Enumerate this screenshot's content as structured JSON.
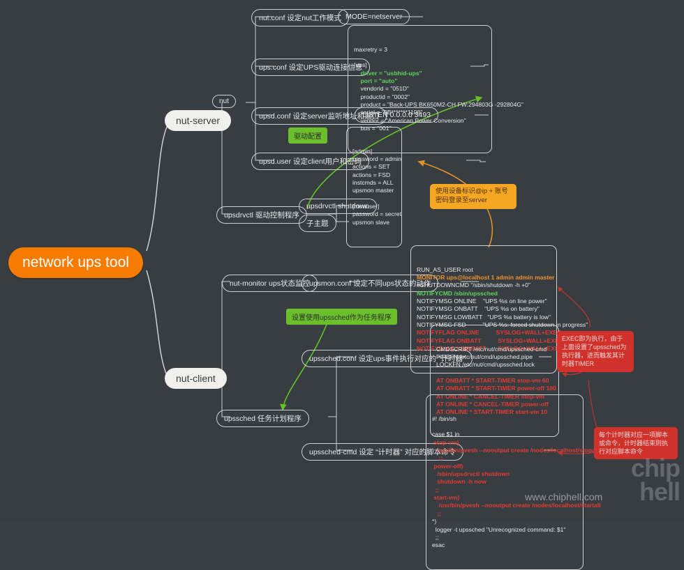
{
  "root": {
    "label": "network ups tool"
  },
  "branches": {
    "server": {
      "label": "nut-server"
    },
    "client": {
      "label": "nut-client"
    }
  },
  "server_tree": {
    "nut": {
      "label": "nut"
    },
    "nut_conf": {
      "label": "nut.conf  设定nut工作模式"
    },
    "nut_conf_value": {
      "label": "MODE=netserver"
    },
    "ups_conf": {
      "label": "ups.conf  设定UPS驱动连接信息"
    },
    "upsd_conf": {
      "label": "upsd.conf  设定server监听地址和端口"
    },
    "upsd_conf_value": {
      "label": "LISTEN 0.0.0.0 3493"
    },
    "upsd_user": {
      "label": "upsd.user  设定client用户和密码"
    },
    "upsdrvctl": {
      "label": "upsdrvctl  驱动控制程序"
    },
    "upsdrvctl_child1": {
      "label": "upsdrvctl shutdown"
    },
    "upsdrvctl_child2": {
      "label": "子主题"
    }
  },
  "client_tree": {
    "nut_monitor": {
      "label": "nut-monitor  ups状态监控"
    },
    "upsmon_conf": {
      "label": "upsmon.conf  设定不同ups状态的动作"
    },
    "upssched": {
      "label": "upssched   任务计划程序"
    },
    "upssched_conf": {
      "label": "upssched.conf  设定ups事件执行对应的 “计时器”"
    },
    "upssched_cmd": {
      "label": "upssched-cmd  设定 “计时器” 对应的脚本命令"
    }
  },
  "ups_conf_content": {
    "lines": [
      {
        "text": "maxretry = 3",
        "color": "w"
      },
      {
        "text": "",
        "color": "w"
      },
      {
        "text": "[ups]",
        "color": "w"
      },
      {
        "text": "    driver = \"usbhid-ups\"",
        "color": "g"
      },
      {
        "text": "    port = \"auto\"",
        "color": "g"
      },
      {
        "text": "    vendorid = \"051D\"",
        "color": "w"
      },
      {
        "text": "    productid = \"0002\"",
        "color": "w"
      },
      {
        "text": "    product = \"Back-UPS BK650M2-CH FW:294803G -292804G\"",
        "color": "w"
      },
      {
        "text": "    serial = \"9B*******1108\"",
        "color": "w"
      },
      {
        "text": "    vendor = \"American Power Conversion\"",
        "color": "w"
      },
      {
        "text": "    bus = \"001\"",
        "color": "w"
      }
    ]
  },
  "upsd_user_content": {
    "lines": [
      {
        "text": "[admin]",
        "color": "w"
      },
      {
        "text": "password = admin",
        "color": "w"
      },
      {
        "text": "actions = SET",
        "color": "w"
      },
      {
        "text": "actions = FSD",
        "color": "w"
      },
      {
        "text": "instcmds = ALL",
        "color": "w"
      },
      {
        "text": "upsmon master",
        "color": "w"
      },
      {
        "text": "",
        "color": "w"
      },
      {
        "text": "[monuser]",
        "color": "w"
      },
      {
        "text": "password = secret",
        "color": "w"
      },
      {
        "text": "upsmon slave",
        "color": "w"
      }
    ]
  },
  "upsmon_conf_content": {
    "lines": [
      {
        "text": "RUN_AS_USER root",
        "color": "w"
      },
      {
        "text": "MONITOR ups@localhost 1 admin admin master",
        "color": "o"
      },
      {
        "text": "#SHUTDOWNCMD \"/sbin/shutdown -h +0\"",
        "color": "w"
      },
      {
        "text": "NOTIFYCMD /sbin/upssched",
        "color": "g"
      },
      {
        "text": "NOTIFYMSG ONLINE    \"UPS %s on line power\"",
        "color": "w"
      },
      {
        "text": "NOTIFYMSG ONBATT    \"UPS %s on battery\"",
        "color": "w"
      },
      {
        "text": "NOTIFYMSG LOWBATT   \"UPS %s battery is low\"",
        "color": "w"
      },
      {
        "text": "NOTIFYMSG FSD          \"UPS %s: forced shutdown in progress\"",
        "color": "w"
      },
      {
        "text": "NOTIFYFLAG ONLINE          SYSLOG+WALL+EXEC",
        "color": "r"
      },
      {
        "text": "NOTIFYFLAG ONBATT          SYSLOG+WALL+EXEC",
        "color": "r"
      },
      {
        "text": "NOTIFYFLAG LOWBATT       SYSLOG+WALL+EXEC",
        "color": "r"
      }
    ]
  },
  "upssched_conf_content": {
    "lines": [
      {
        "text": "CMDSCRIPT /etc/nut/cmd/upssched-cmd",
        "color": "w"
      },
      {
        "text": "PIPEFN /etc/nut/cmd/upssched.pipe",
        "color": "w"
      },
      {
        "text": "LOCKFN /etc/nut/cmd/upssched.lock",
        "color": "w"
      },
      {
        "text": "",
        "color": "w"
      },
      {
        "text": "AT ONBATT * START-TIMER stop-vm 60",
        "color": "r"
      },
      {
        "text": "AT ONBATT * START-TIMER power-off 180",
        "color": "r"
      },
      {
        "text": "AT ONLINE * CANCEL-TIMER stop-vm",
        "color": "r"
      },
      {
        "text": "AT ONLINE * CANCEL-TIMER power-off",
        "color": "r"
      },
      {
        "text": "AT ONLINE * START-TIMER start-vm 10",
        "color": "r"
      }
    ]
  },
  "upssched_cmd_content": {
    "lines": [
      {
        "text": "#! /bin/sh",
        "color": "w"
      },
      {
        "text": "",
        "color": "w"
      },
      {
        "text": "case $1 in",
        "color": "w"
      },
      {
        "text": " stop-vm)",
        "color": "r"
      },
      {
        "text": "   /usr/bin/pvesh --nooutput create /nodes/localhost/stopall",
        "color": "r"
      },
      {
        "text": "    ;;",
        "color": "r"
      },
      {
        "text": " power-off)",
        "color": "r"
      },
      {
        "text": "   /sbin/upsdrvctl shutdown",
        "color": "r"
      },
      {
        "text": "   shutdown -h now",
        "color": "r"
      },
      {
        "text": "  ;;",
        "color": "r"
      },
      {
        "text": " start-vm)",
        "color": "r"
      },
      {
        "text": "    /usr/bin/pvesh --nooutput create /nodes/localhost/startall",
        "color": "r"
      },
      {
        "text": "   ;;",
        "color": "r"
      },
      {
        "text": "*)",
        "color": "w"
      },
      {
        "text": "  logger -t upssched \"Unrecognized command: $1\"",
        "color": "w"
      },
      {
        "text": "  ;;",
        "color": "w"
      },
      {
        "text": "esac",
        "color": "w"
      }
    ]
  },
  "notes": {
    "green_driver": {
      "label": "驱动配置"
    },
    "green_upssched": {
      "label": "设置使用upssched作为任务程序"
    },
    "orange_login": {
      "label": "使用设备标识@ip + 账号密码登录至server"
    },
    "red_exec": {
      "label": "EXEC即为执行，由于上面设置了upssched为执行器，进而触发其计时器TIMER"
    },
    "red_timer": {
      "label": "每个计时器对应一项脚本或命令，计时器结束则执行对应脚本命令"
    }
  },
  "watermark": {
    "label": "www.chiphell.com",
    "logo_top": "chip",
    "logo_bottom": "hell"
  },
  "colors": {
    "background": "#383d42",
    "root_orange": "#f57c00",
    "note_green": "#6abf2a",
    "note_orange": "#f5a623",
    "note_red": "#d0312b",
    "code_green": "#5fd35f",
    "code_orange": "#f0922b",
    "code_red": "#e03b32",
    "line": "#d8dadd"
  }
}
